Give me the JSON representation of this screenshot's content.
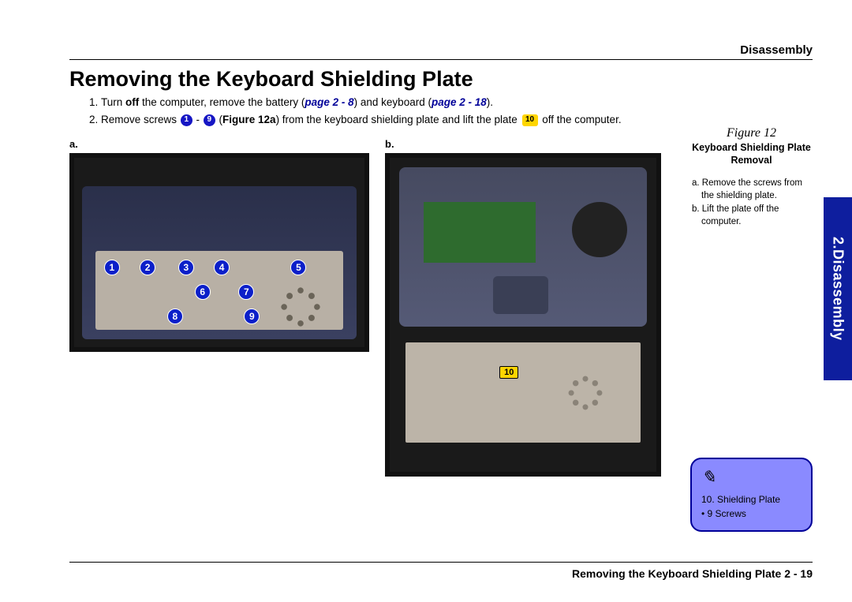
{
  "header": {
    "section": "Disassembly"
  },
  "title": "Removing the Keyboard Shielding Plate",
  "steps": {
    "s1_pre": "Turn ",
    "s1_off": "off",
    "s1_mid1": " the computer, remove the battery (",
    "s1_ref1": "page 2 - 8",
    "s1_mid2": ") and keyboard (",
    "s1_ref2": "page 2 - 18",
    "s1_end": ").",
    "s2_pre": "Remove screws ",
    "s2_c1": "1",
    "s2_dash": " - ",
    "s2_c9": "9",
    "s2_mid1": " (",
    "s2_figref": "Figure 12a",
    "s2_mid2": ") from the keyboard shielding plate and lift the plate ",
    "s2_c10": "10",
    "s2_end": " off the computer."
  },
  "figlabels": {
    "a": "a.",
    "b": "b."
  },
  "screws": {
    "1": "1",
    "2": "2",
    "3": "3",
    "4": "4",
    "5": "5",
    "6": "6",
    "7": "7",
    "8": "8",
    "9": "9",
    "10": "10"
  },
  "sidebar": {
    "fig_title": "Figure 12",
    "fig_sub": "Keyboard Shielding Plate Removal",
    "step_a": "a. Remove the screws from the shielding plate.",
    "step_b": "b. Lift the plate off the computer."
  },
  "sidetab": "2.Disassembly",
  "note": {
    "pencil": "✎",
    "line1": "10. Shielding Plate",
    "line2": "•  9 Screws"
  },
  "footer": "Removing the Keyboard Shielding Plate   2  -  19"
}
